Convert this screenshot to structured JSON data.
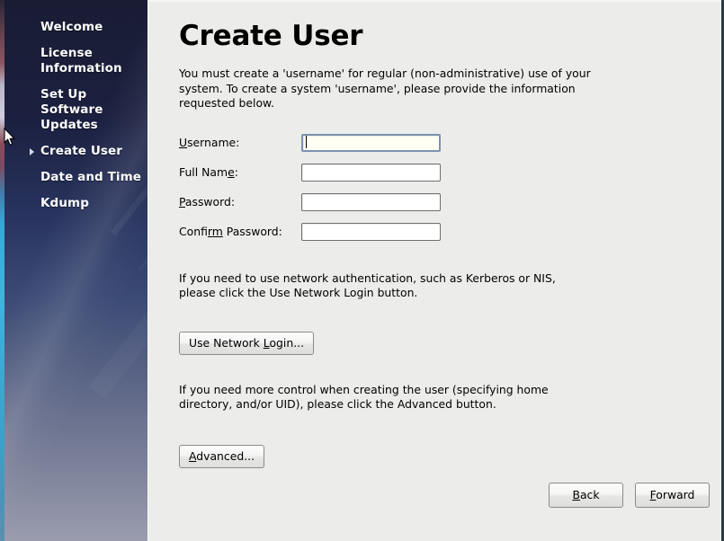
{
  "sidebar": {
    "items": [
      {
        "label": "Welcome",
        "active": false
      },
      {
        "label": "License Information",
        "active": false
      },
      {
        "label": "Set Up Software Updates",
        "active": false
      },
      {
        "label": "Create User",
        "active": true
      },
      {
        "label": "Date and Time",
        "active": false
      },
      {
        "label": "Kdump",
        "active": false
      }
    ]
  },
  "main": {
    "title": "Create User",
    "intro": "You must create a 'username' for regular (non-administrative) use of your\nsystem.  To create a system 'username', please provide the information\nrequested below.",
    "form": {
      "fields": [
        {
          "label_pre": "",
          "label_mn": "U",
          "label_post": "sername:",
          "value": "",
          "placeholder": "",
          "focused": true,
          "name": "username"
        },
        {
          "label_pre": "Full Nam",
          "label_mn": "e",
          "label_post": ":",
          "value": "",
          "placeholder": "",
          "focused": false,
          "name": "full-name"
        },
        {
          "label_pre": "",
          "label_mn": "P",
          "label_post": "assword:",
          "value": "",
          "placeholder": "",
          "focused": false,
          "name": "password"
        },
        {
          "label_pre": "Confi",
          "label_mn": "rm",
          "label_post": " Password:",
          "value": "",
          "placeholder": "",
          "focused": false,
          "name": "confirm-password"
        }
      ]
    },
    "network_note": "If you need to use network authentication, such as Kerberos or NIS,\nplease click the Use Network Login button.",
    "network_button": {
      "pre": "Use Network ",
      "mn": "L",
      "post": "ogin..."
    },
    "advanced_note": "If you need more control when creating the user (specifying home\ndirectory, and/or UID), please click the Advanced button.",
    "advanced_button": {
      "pre": "",
      "mn": "A",
      "post": "dvanced..."
    }
  },
  "bottom_nav": {
    "back": {
      "pre": "",
      "mn": "B",
      "post": "ack"
    },
    "forward": {
      "pre": "",
      "mn": "F",
      "post": "orward"
    }
  },
  "colors": {
    "content_bg": "#ececea",
    "sidebar_top": "#191c33",
    "sidebar_bottom": "#9a9cae",
    "focus_border": "#7c92ae",
    "frame_right": "#2c3946"
  }
}
